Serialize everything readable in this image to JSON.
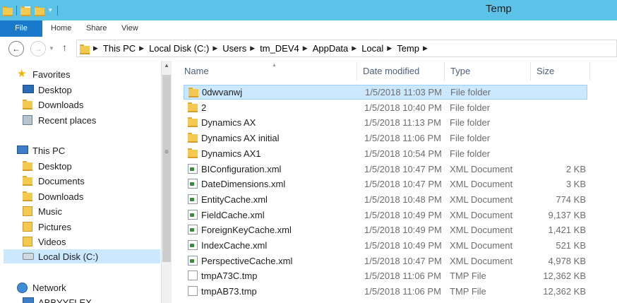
{
  "window": {
    "title": "Temp"
  },
  "ribbon": {
    "tabs": [
      "File",
      "Home",
      "Share",
      "View"
    ]
  },
  "address": {
    "crumbs": [
      "This PC",
      "Local Disk (C:)",
      "Users",
      "tm_DEV4",
      "AppData",
      "Local",
      "Temp"
    ]
  },
  "navigation": {
    "favorites": {
      "label": "Favorites",
      "items": [
        "Desktop",
        "Downloads",
        "Recent places"
      ]
    },
    "this_pc": {
      "label": "This PC",
      "items": [
        "Desktop",
        "Documents",
        "Downloads",
        "Music",
        "Pictures",
        "Videos",
        "Local Disk (C:)"
      ]
    },
    "network": {
      "label": "Network",
      "items": [
        "ABBYYFLEX"
      ]
    }
  },
  "columns": {
    "name": "Name",
    "date": "Date modified",
    "type": "Type",
    "size": "Size"
  },
  "files": [
    {
      "name": "0dwvanwj",
      "date": "1/5/2018 11:03 PM",
      "type": "File folder",
      "size": "",
      "icon": "folder-icon"
    },
    {
      "name": "2",
      "date": "1/5/2018 10:40 PM",
      "type": "File folder",
      "size": "",
      "icon": "folder-icon"
    },
    {
      "name": "Dynamics AX",
      "date": "1/5/2018 11:13 PM",
      "type": "File folder",
      "size": "",
      "icon": "folder-icon"
    },
    {
      "name": "Dynamics AX initial",
      "date": "1/5/2018 11:06 PM",
      "type": "File folder",
      "size": "",
      "icon": "folder-icon"
    },
    {
      "name": "Dynamics AX1",
      "date": "1/5/2018 10:54 PM",
      "type": "File folder",
      "size": "",
      "icon": "folder-icon"
    },
    {
      "name": "BIConfiguration.xml",
      "date": "1/5/2018 10:47 PM",
      "type": "XML Document",
      "size": "2 KB",
      "icon": "xml-file-icon"
    },
    {
      "name": "DateDimensions.xml",
      "date": "1/5/2018 10:47 PM",
      "type": "XML Document",
      "size": "3 KB",
      "icon": "xml-file-icon"
    },
    {
      "name": "EntityCache.xml",
      "date": "1/5/2018 10:48 PM",
      "type": "XML Document",
      "size": "774 KB",
      "icon": "xml-file-icon"
    },
    {
      "name": "FieldCache.xml",
      "date": "1/5/2018 10:49 PM",
      "type": "XML Document",
      "size": "9,137 KB",
      "icon": "xml-file-icon"
    },
    {
      "name": "ForeignKeyCache.xml",
      "date": "1/5/2018 10:49 PM",
      "type": "XML Document",
      "size": "1,421 KB",
      "icon": "xml-file-icon"
    },
    {
      "name": "IndexCache.xml",
      "date": "1/5/2018 10:49 PM",
      "type": "XML Document",
      "size": "521 KB",
      "icon": "xml-file-icon"
    },
    {
      "name": "PerspectiveCache.xml",
      "date": "1/5/2018 10:47 PM",
      "type": "XML Document",
      "size": "4,978 KB",
      "icon": "xml-file-icon"
    },
    {
      "name": "tmpA73C.tmp",
      "date": "1/5/2018 11:06 PM",
      "type": "TMP File",
      "size": "12,362 KB",
      "icon": "tmp-file-icon"
    },
    {
      "name": "tmpAB73.tmp",
      "date": "1/5/2018 11:06 PM",
      "type": "TMP File",
      "size": "12,362 KB",
      "icon": "tmp-file-icon"
    }
  ],
  "selected_file": "0dwvanwj",
  "colors": {
    "titlebar": "#5bc3e8",
    "file_tab": "#1979ca",
    "selection": "#cce8ff"
  }
}
